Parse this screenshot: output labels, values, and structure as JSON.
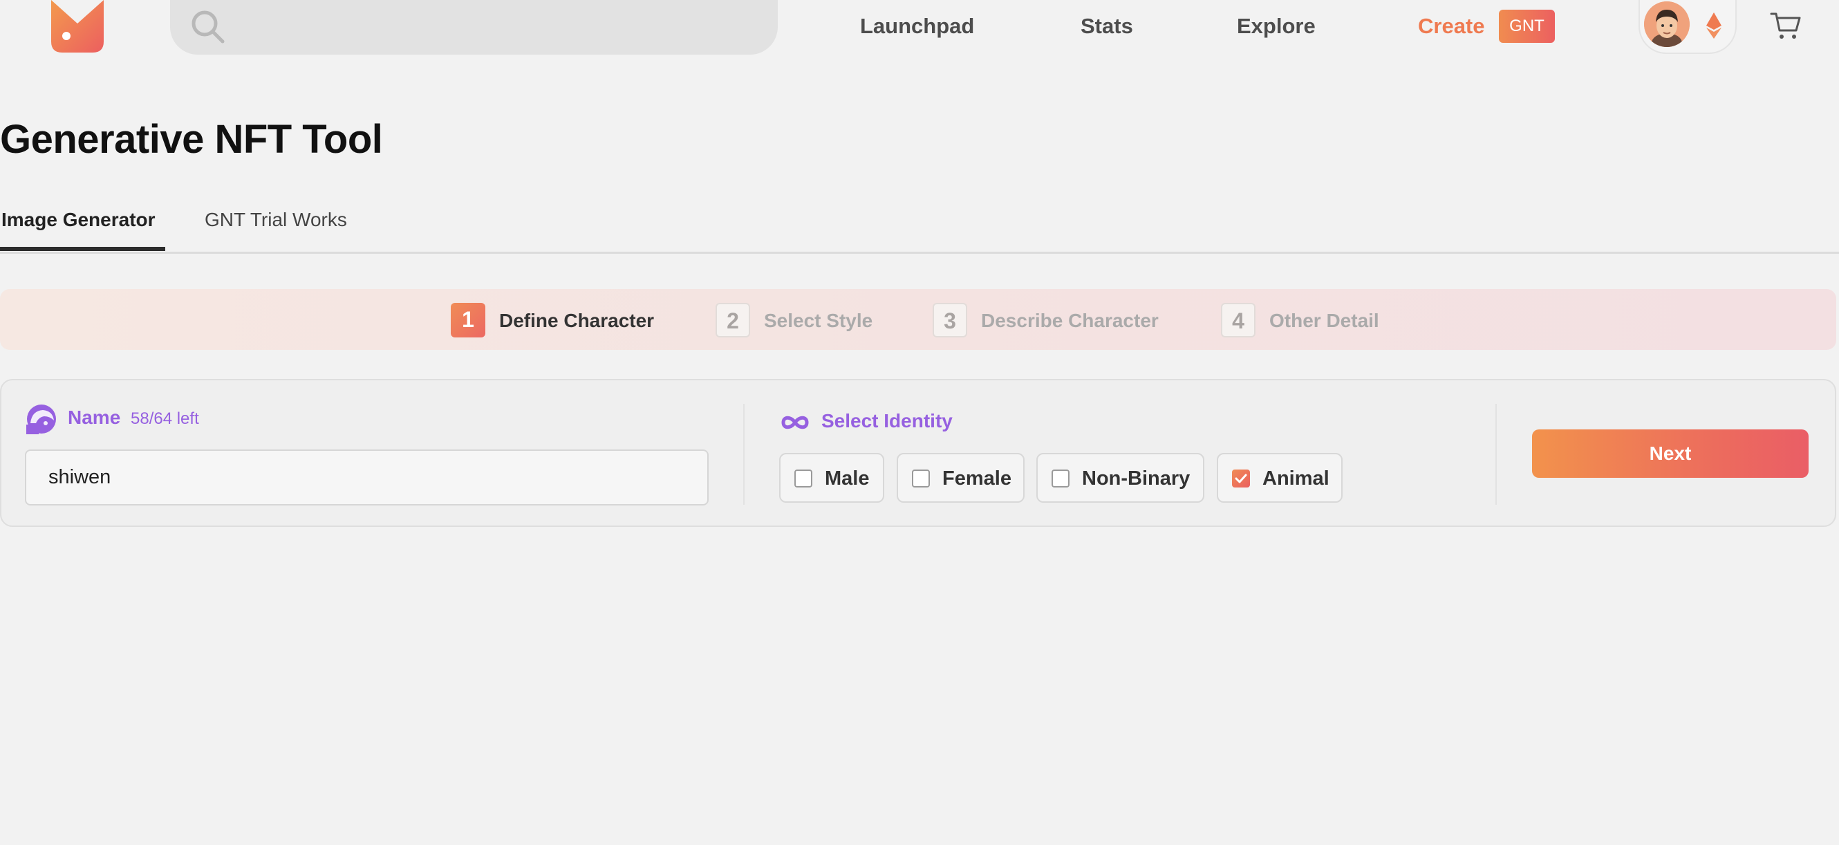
{
  "header": {
    "search": {
      "placeholder": "",
      "value": ""
    },
    "nav": {
      "launchpad": "Launchpad",
      "stats": "Stats",
      "explore": "Explore",
      "create": "Create",
      "create_badge": "GNT"
    }
  },
  "page": {
    "title": "Generative NFT Tool",
    "tabs": [
      {
        "label": "Image Generator",
        "active": true
      },
      {
        "label": "GNT Trial Works",
        "active": false
      }
    ]
  },
  "stepper": {
    "steps": [
      {
        "number": "1",
        "label": "Define Character",
        "active": true
      },
      {
        "number": "2",
        "label": "Select Style",
        "active": false
      },
      {
        "number": "3",
        "label": "Describe Character",
        "active": false
      },
      {
        "number": "4",
        "label": "Other Detail",
        "active": false
      }
    ]
  },
  "form": {
    "name": {
      "label": "Name",
      "counter": "58/64 left",
      "value": "shiwen"
    },
    "identity": {
      "label": "Select Identity",
      "options": [
        {
          "label": "Male",
          "checked": false
        },
        {
          "label": "Female",
          "checked": false
        },
        {
          "label": "Non-Binary",
          "checked": false
        },
        {
          "label": "Animal",
          "checked": true
        }
      ]
    },
    "next_label": "Next"
  },
  "colors": {
    "accent": "#ef7a50",
    "purple": "#9660e0",
    "background": "#f2f2f2"
  }
}
